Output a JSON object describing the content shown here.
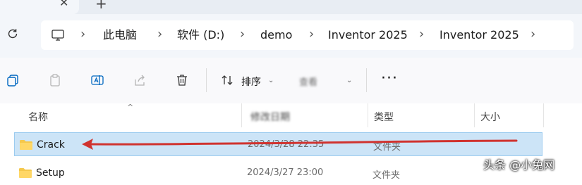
{
  "breadcrumb": {
    "items": [
      "此电脑",
      "软件 (D:)",
      "demo",
      "Inventor 2025",
      "Inventor 2025"
    ]
  },
  "toolbar": {
    "sort_label": "排序",
    "view_label": "查看",
    "more_label": "···"
  },
  "columns": {
    "name": "名称",
    "date": "修改日期",
    "type": "类型",
    "size": "大小"
  },
  "files": [
    {
      "name": "Crack",
      "date": "2024/3/28 22:35",
      "type": "文件夹",
      "selected": true
    },
    {
      "name": "Setup",
      "date": "2024/3/27 23:00",
      "type": "文件夹",
      "selected": false
    }
  ],
  "watermark": "头条 @小兔网",
  "colors": {
    "selection": "#cce4f7",
    "arrow": "#d0332f",
    "folder": "#f5c84c",
    "accent": "#0067c0"
  }
}
